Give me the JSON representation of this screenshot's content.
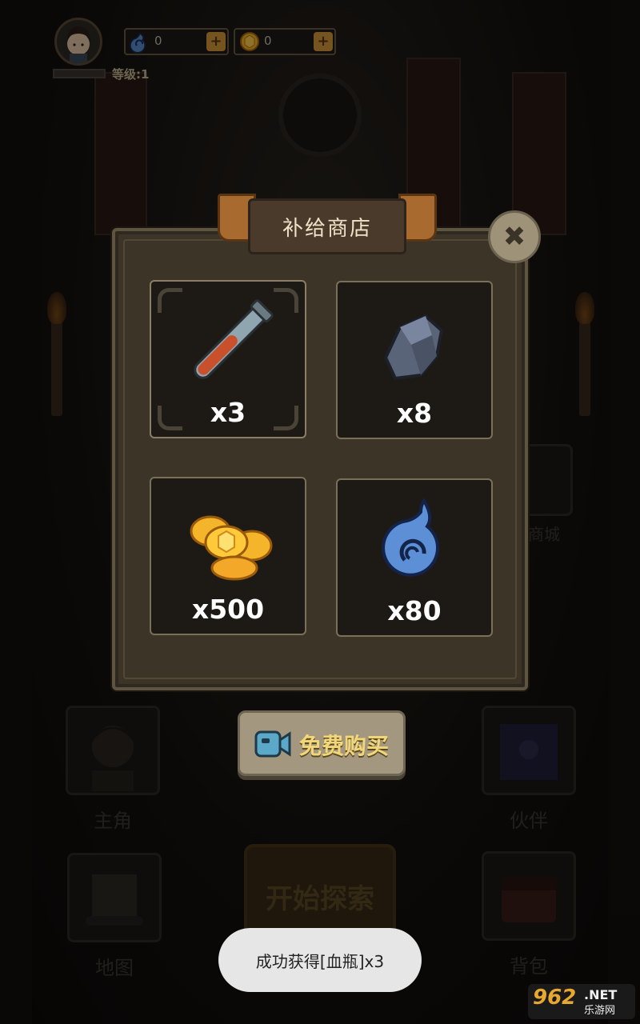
{
  "hud": {
    "level_text": "等级:1",
    "spirit_amount": "0",
    "gold_amount": "0",
    "plus": "+"
  },
  "background": {
    "menu_hero": "主角",
    "menu_partner": "伙伴",
    "menu_map": "地图",
    "menu_bag": "背包",
    "menu_mall": "商城",
    "start_button": "开始探索"
  },
  "shop": {
    "title": "补给商店",
    "close_symbol": "✖",
    "items": [
      {
        "icon": "blood-vial-icon",
        "qty": "x3",
        "selected": true
      },
      {
        "icon": "ore-stone-icon",
        "qty": "x8",
        "selected": false
      },
      {
        "icon": "gold-coins-icon",
        "qty": "x500",
        "selected": false
      },
      {
        "icon": "blue-spirit-icon",
        "qty": "x80",
        "selected": false
      }
    ],
    "buy_label": "免费购买",
    "buy_icon": "video-camera-icon"
  },
  "toast": {
    "message": "成功获得[血瓶]x3"
  },
  "watermark": {
    "number": "962",
    "net": ".NET",
    "cn": "乐游网"
  },
  "colors": {
    "gold_text": "#f2d77a",
    "panel": "#3c3527",
    "plus_button": "#d89a3a"
  }
}
